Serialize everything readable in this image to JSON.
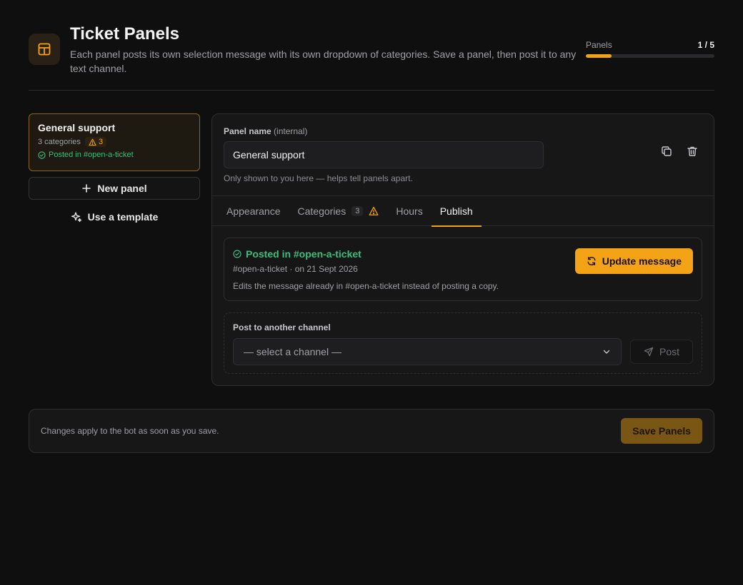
{
  "header": {
    "title": "Ticket Panels",
    "description": "Each panel posts its own selection message with its own dropdown of categories. Save a panel, then post it to any text channel.",
    "meter_label": "Panels",
    "meter_count": "1 / 5",
    "meter_fraction": 0.2,
    "icon": "layout-panel-icon"
  },
  "sidebar": {
    "panels": [
      {
        "name": "General support",
        "categories_label": "3 categories",
        "warning_count": "3",
        "posted_label": "Posted in #open-a-ticket"
      }
    ],
    "new_panel_label": "New panel",
    "template_label": "Use a template"
  },
  "editor": {
    "name_label": "Panel name",
    "name_label_sub": "(internal)",
    "name_value": "General support",
    "name_help": "Only shown to you here — helps tell panels apart.",
    "tabs": [
      {
        "label": "Appearance"
      },
      {
        "label": "Categories",
        "count": "3"
      },
      {
        "label": "Hours"
      },
      {
        "label": "Publish"
      }
    ],
    "active_tab": "Publish",
    "publish": {
      "posted_title": "Posted in #open-a-ticket",
      "posted_meta": "#open-a-ticket · on 21 Sept 2026",
      "posted_note": "Edits the message already in #open-a-ticket instead of posting a copy.",
      "update_label": "Update message",
      "post_other_label": "Post to another channel",
      "channel_placeholder": "— select a channel —",
      "post_label": "Post"
    }
  },
  "footer": {
    "note": "Changes apply to the bot as soon as you save.",
    "save_label": "Save Panels"
  },
  "colors": {
    "accent": "#f5a316",
    "success": "#3dbd7d",
    "background": "#0f0f10"
  }
}
